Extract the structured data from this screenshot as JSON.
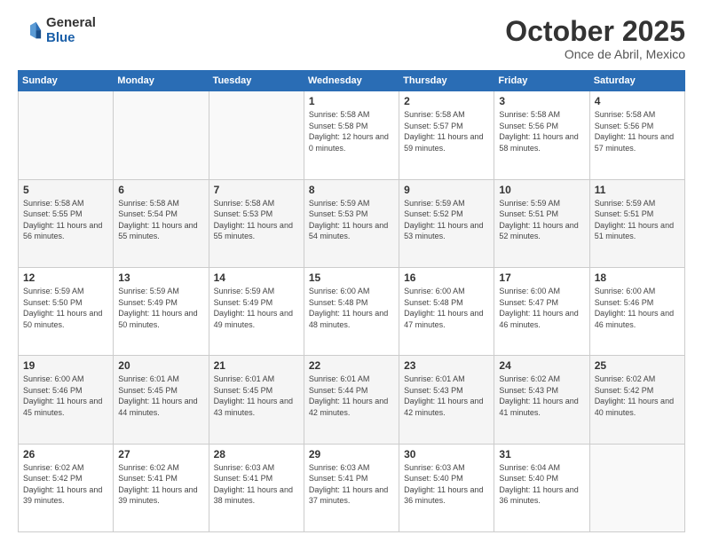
{
  "logo": {
    "general": "General",
    "blue": "Blue"
  },
  "header": {
    "month": "October 2025",
    "location": "Once de Abril, Mexico"
  },
  "weekdays": [
    "Sunday",
    "Monday",
    "Tuesday",
    "Wednesday",
    "Thursday",
    "Friday",
    "Saturday"
  ],
  "weeks": [
    [
      {
        "day": "",
        "sunrise": "",
        "sunset": "",
        "daylight": "",
        "empty": true
      },
      {
        "day": "",
        "sunrise": "",
        "sunset": "",
        "daylight": "",
        "empty": true
      },
      {
        "day": "",
        "sunrise": "",
        "sunset": "",
        "daylight": "",
        "empty": true
      },
      {
        "day": "1",
        "sunrise": "Sunrise: 5:58 AM",
        "sunset": "Sunset: 5:58 PM",
        "daylight": "Daylight: 12 hours and 0 minutes."
      },
      {
        "day": "2",
        "sunrise": "Sunrise: 5:58 AM",
        "sunset": "Sunset: 5:57 PM",
        "daylight": "Daylight: 11 hours and 59 minutes."
      },
      {
        "day": "3",
        "sunrise": "Sunrise: 5:58 AM",
        "sunset": "Sunset: 5:56 PM",
        "daylight": "Daylight: 11 hours and 58 minutes."
      },
      {
        "day": "4",
        "sunrise": "Sunrise: 5:58 AM",
        "sunset": "Sunset: 5:56 PM",
        "daylight": "Daylight: 11 hours and 57 minutes."
      }
    ],
    [
      {
        "day": "5",
        "sunrise": "Sunrise: 5:58 AM",
        "sunset": "Sunset: 5:55 PM",
        "daylight": "Daylight: 11 hours and 56 minutes."
      },
      {
        "day": "6",
        "sunrise": "Sunrise: 5:58 AM",
        "sunset": "Sunset: 5:54 PM",
        "daylight": "Daylight: 11 hours and 55 minutes."
      },
      {
        "day": "7",
        "sunrise": "Sunrise: 5:58 AM",
        "sunset": "Sunset: 5:53 PM",
        "daylight": "Daylight: 11 hours and 55 minutes."
      },
      {
        "day": "8",
        "sunrise": "Sunrise: 5:59 AM",
        "sunset": "Sunset: 5:53 PM",
        "daylight": "Daylight: 11 hours and 54 minutes."
      },
      {
        "day": "9",
        "sunrise": "Sunrise: 5:59 AM",
        "sunset": "Sunset: 5:52 PM",
        "daylight": "Daylight: 11 hours and 53 minutes."
      },
      {
        "day": "10",
        "sunrise": "Sunrise: 5:59 AM",
        "sunset": "Sunset: 5:51 PM",
        "daylight": "Daylight: 11 hours and 52 minutes."
      },
      {
        "day": "11",
        "sunrise": "Sunrise: 5:59 AM",
        "sunset": "Sunset: 5:51 PM",
        "daylight": "Daylight: 11 hours and 51 minutes."
      }
    ],
    [
      {
        "day": "12",
        "sunrise": "Sunrise: 5:59 AM",
        "sunset": "Sunset: 5:50 PM",
        "daylight": "Daylight: 11 hours and 50 minutes."
      },
      {
        "day": "13",
        "sunrise": "Sunrise: 5:59 AM",
        "sunset": "Sunset: 5:49 PM",
        "daylight": "Daylight: 11 hours and 50 minutes."
      },
      {
        "day": "14",
        "sunrise": "Sunrise: 5:59 AM",
        "sunset": "Sunset: 5:49 PM",
        "daylight": "Daylight: 11 hours and 49 minutes."
      },
      {
        "day": "15",
        "sunrise": "Sunrise: 6:00 AM",
        "sunset": "Sunset: 5:48 PM",
        "daylight": "Daylight: 11 hours and 48 minutes."
      },
      {
        "day": "16",
        "sunrise": "Sunrise: 6:00 AM",
        "sunset": "Sunset: 5:48 PM",
        "daylight": "Daylight: 11 hours and 47 minutes."
      },
      {
        "day": "17",
        "sunrise": "Sunrise: 6:00 AM",
        "sunset": "Sunset: 5:47 PM",
        "daylight": "Daylight: 11 hours and 46 minutes."
      },
      {
        "day": "18",
        "sunrise": "Sunrise: 6:00 AM",
        "sunset": "Sunset: 5:46 PM",
        "daylight": "Daylight: 11 hours and 46 minutes."
      }
    ],
    [
      {
        "day": "19",
        "sunrise": "Sunrise: 6:00 AM",
        "sunset": "Sunset: 5:46 PM",
        "daylight": "Daylight: 11 hours and 45 minutes."
      },
      {
        "day": "20",
        "sunrise": "Sunrise: 6:01 AM",
        "sunset": "Sunset: 5:45 PM",
        "daylight": "Daylight: 11 hours and 44 minutes."
      },
      {
        "day": "21",
        "sunrise": "Sunrise: 6:01 AM",
        "sunset": "Sunset: 5:45 PM",
        "daylight": "Daylight: 11 hours and 43 minutes."
      },
      {
        "day": "22",
        "sunrise": "Sunrise: 6:01 AM",
        "sunset": "Sunset: 5:44 PM",
        "daylight": "Daylight: 11 hours and 42 minutes."
      },
      {
        "day": "23",
        "sunrise": "Sunrise: 6:01 AM",
        "sunset": "Sunset: 5:43 PM",
        "daylight": "Daylight: 11 hours and 42 minutes."
      },
      {
        "day": "24",
        "sunrise": "Sunrise: 6:02 AM",
        "sunset": "Sunset: 5:43 PM",
        "daylight": "Daylight: 11 hours and 41 minutes."
      },
      {
        "day": "25",
        "sunrise": "Sunrise: 6:02 AM",
        "sunset": "Sunset: 5:42 PM",
        "daylight": "Daylight: 11 hours and 40 minutes."
      }
    ],
    [
      {
        "day": "26",
        "sunrise": "Sunrise: 6:02 AM",
        "sunset": "Sunset: 5:42 PM",
        "daylight": "Daylight: 11 hours and 39 minutes."
      },
      {
        "day": "27",
        "sunrise": "Sunrise: 6:02 AM",
        "sunset": "Sunset: 5:41 PM",
        "daylight": "Daylight: 11 hours and 39 minutes."
      },
      {
        "day": "28",
        "sunrise": "Sunrise: 6:03 AM",
        "sunset": "Sunset: 5:41 PM",
        "daylight": "Daylight: 11 hours and 38 minutes."
      },
      {
        "day": "29",
        "sunrise": "Sunrise: 6:03 AM",
        "sunset": "Sunset: 5:41 PM",
        "daylight": "Daylight: 11 hours and 37 minutes."
      },
      {
        "day": "30",
        "sunrise": "Sunrise: 6:03 AM",
        "sunset": "Sunset: 5:40 PM",
        "daylight": "Daylight: 11 hours and 36 minutes."
      },
      {
        "day": "31",
        "sunrise": "Sunrise: 6:04 AM",
        "sunset": "Sunset: 5:40 PM",
        "daylight": "Daylight: 11 hours and 36 minutes."
      },
      {
        "day": "",
        "sunrise": "",
        "sunset": "",
        "daylight": "",
        "empty": true
      }
    ]
  ]
}
